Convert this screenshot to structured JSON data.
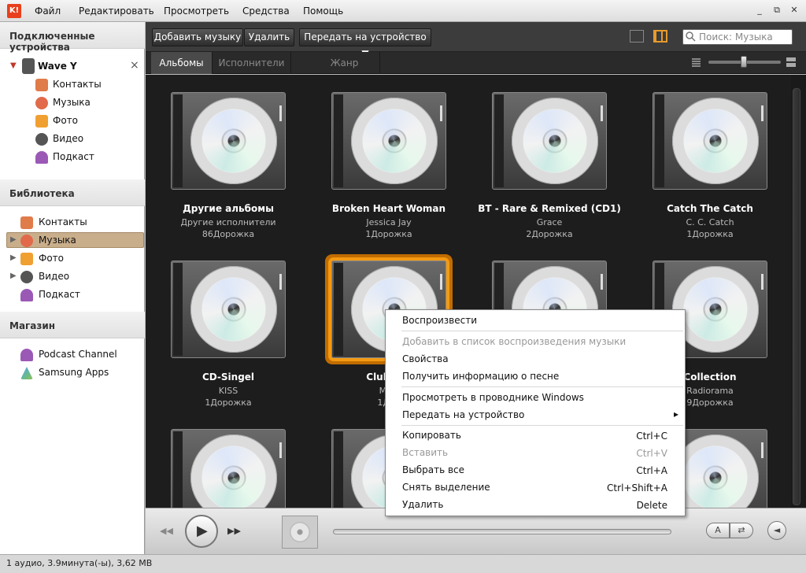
{
  "menubar": {
    "logo": "K!",
    "items": [
      "Файл",
      "Редактировать",
      "Просмотреть",
      "Средства",
      "Помощь"
    ],
    "window_buttons": [
      "_",
      "⧉",
      "✕"
    ]
  },
  "sidebar": {
    "connected_header": "Подключенные устройства",
    "device": {
      "name": "Wave Y",
      "close": "×"
    },
    "device_items": [
      "Контакты",
      "Музыка",
      "Фото",
      "Видео",
      "Подкаст"
    ],
    "library_header": "Библиотека",
    "library_items": [
      "Контакты",
      "Музыка",
      "Фото",
      "Видео",
      "Подкаст"
    ],
    "library_selected": "Музыка",
    "store_header": "Магазин",
    "store_items": [
      "Podcast Channel",
      "Samsung Apps"
    ]
  },
  "toolbar": {
    "add_music": "Добавить музыку",
    "delete": "Удалить",
    "send_to_device": "Передать на устройство ▼",
    "search_placeholder": "Поиск: Музыка"
  },
  "tabs": {
    "items": [
      "Альбомы",
      "Исполнители",
      "Жанр"
    ],
    "active": "Альбомы"
  },
  "albums": [
    {
      "title": "Другие альбомы",
      "artist": "Другие исполнители",
      "tracks": "86Дорожка"
    },
    {
      "title": "Broken Heart Woman",
      "artist": "Jessica Jay",
      "tracks": "1Дорожка"
    },
    {
      "title": "BT - Rare & Remixed (CD1)",
      "artist": "Grace",
      "tracks": "2Дорожка"
    },
    {
      "title": "Catch The Catch",
      "artist": "C. C. Catch",
      "tracks": "1Дорожка"
    },
    {
      "title": "CD-Singel",
      "artist": "KISS",
      "tracks": "1Дорожка"
    },
    {
      "title": "Club Rot",
      "artist": "Matt",
      "tracks": "1Дор"
    },
    {
      "title": "",
      "artist": "",
      "tracks": ""
    },
    {
      "title": "Collection",
      "artist": "Radiorama",
      "tracks": "9Дорожка"
    },
    {
      "title": "",
      "artist": "",
      "tracks": ""
    },
    {
      "title": "",
      "artist": "",
      "tracks": ""
    },
    {
      "title": "",
      "artist": "",
      "tracks": ""
    },
    {
      "title": "",
      "artist": "",
      "tracks": ""
    }
  ],
  "context_menu": {
    "play": "Воспроизвести",
    "add_to_playlist": "Добавить в список воспроизведения музыки",
    "properties": "Свойства",
    "get_info": "Получить информацию о песне",
    "explorer": "Просмотреть в проводнике Windows",
    "send_to_device": "Передать на устройство",
    "copy": "Копировать",
    "copy_sc": "Ctrl+C",
    "paste": "Вставить",
    "paste_sc": "Ctrl+V",
    "select_all": "Выбрать все",
    "select_all_sc": "Ctrl+A",
    "deselect": "Снять выделение",
    "deselect_sc": "Ctrl+Shift+A",
    "delete": "Удалить",
    "delete_sc": "Delete",
    "submenu_arrow": "▸"
  },
  "player": {
    "prev": "◀◀",
    "play": "▶",
    "next": "▶▶"
  },
  "statusbar": {
    "text": "1 аудио, 3.9минута(-ы), 3,62 MB"
  },
  "colors": {
    "accent_orange": "#f39a12",
    "selected_sidebar": "#c9ae8b",
    "grid_background": "#1d1d1d"
  }
}
